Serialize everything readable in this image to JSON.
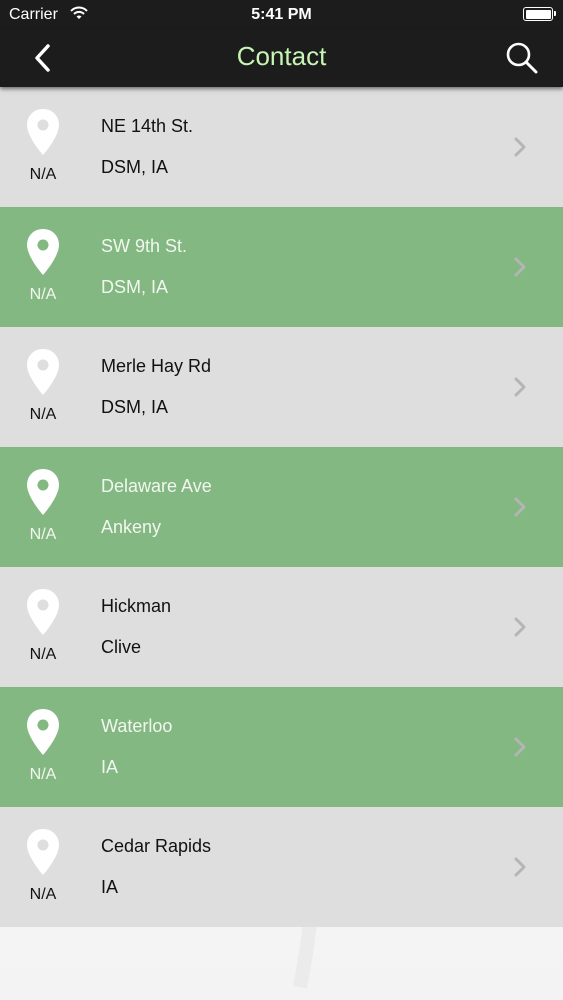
{
  "status_bar": {
    "carrier": "Carrier",
    "time": "5:41 PM"
  },
  "nav": {
    "title": "Contact"
  },
  "colors": {
    "bar_bg": "#1c1c1c",
    "title": "#c6f5b4",
    "row_gray": "#dedede",
    "row_green": "#84b882",
    "text_dark": "#111111",
    "text_light": "#f1f7ef"
  },
  "locations": [
    {
      "line1": "NE 14th St.",
      "line2": "DSM, IA",
      "status": "N/A",
      "highlighted": false
    },
    {
      "line1": "SW 9th St.",
      "line2": "DSM, IA",
      "status": "N/A",
      "highlighted": true
    },
    {
      "line1": "Merle Hay Rd",
      "line2": "DSM, IA",
      "status": "N/A",
      "highlighted": false
    },
    {
      "line1": "Delaware Ave",
      "line2": "Ankeny",
      "status": "N/A",
      "highlighted": true
    },
    {
      "line1": "Hickman",
      "line2": "Clive",
      "status": "N/A",
      "highlighted": false
    },
    {
      "line1": "Waterloo",
      "line2": "IA",
      "status": "N/A",
      "highlighted": true
    },
    {
      "line1": "Cedar Rapids",
      "line2": "IA",
      "status": "N/A",
      "highlighted": false
    }
  ]
}
